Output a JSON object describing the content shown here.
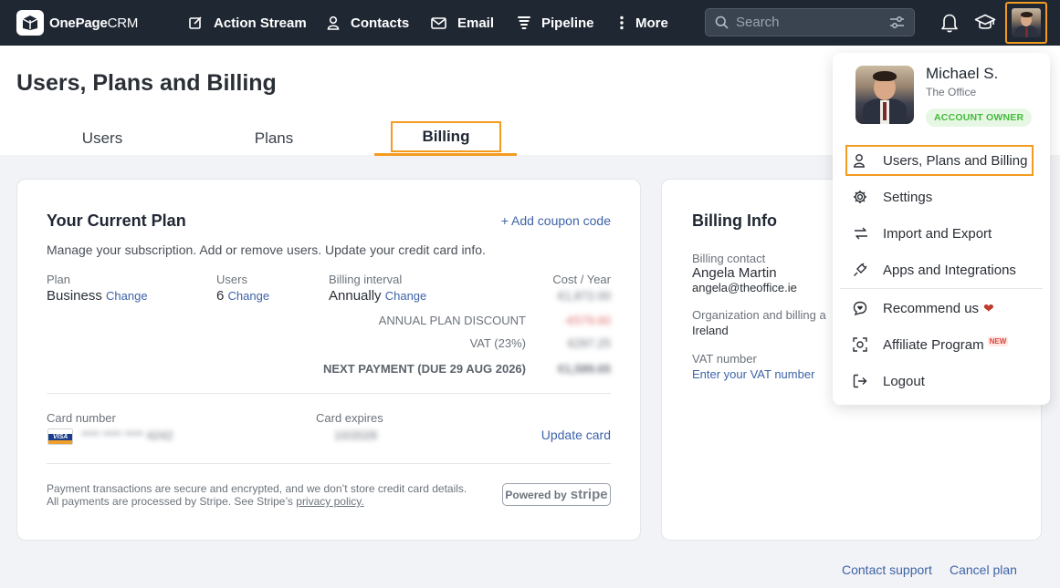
{
  "brand": {
    "name_bold": "OnePage",
    "name_thin": "CRM"
  },
  "nav": {
    "action_stream": "Action Stream",
    "contacts": "Contacts",
    "email": "Email",
    "pipeline": "Pipeline",
    "more": "More"
  },
  "search": {
    "placeholder": "Search"
  },
  "page": {
    "title": "Users, Plans and Billing",
    "tabs": {
      "users": "Users",
      "plans": "Plans",
      "billing": "Billing"
    },
    "active_tab": "Billing"
  },
  "current_plan": {
    "title": "Your Current Plan",
    "add_coupon": "+ Add coupon code",
    "description": "Manage your subscription. Add or remove users. Update your credit card info.",
    "plan_label": "Plan",
    "plan_value": "Business",
    "users_label": "Users",
    "users_value": "6",
    "interval_label": "Billing interval",
    "interval_value": "Annually",
    "change_link": "Change",
    "cost_label": "Cost / Year",
    "cost_value": "€1,872.00",
    "discount_label": "ANNUAL PLAN DISCOUNT",
    "discount_value": "-€579.60",
    "vat_label": "VAT (23%)",
    "vat_value": "€297.25",
    "next_payment_label": "NEXT PAYMENT (DUE 29 AUG 2026)",
    "next_payment_value": "€1,589.65",
    "card_number_label": "Card number",
    "card_number_value": "**** **** **** 4242",
    "card_expires_label": "Card expires",
    "card_expires_value": "10/2028",
    "update_card": "Update card",
    "security_note_1": "Payment transactions are secure and encrypted, and we don’t store credit card details.",
    "security_note_2": "All payments are processed by Stripe. See Stripe’s",
    "privacy_link": "privacy policy.",
    "powered_by": "Powered by",
    "stripe": "stripe"
  },
  "billing_info": {
    "title": "Billing Info",
    "contact_label": "Billing contact",
    "contact_name": "Angela Martin",
    "contact_email": "angela@theoffice.ie",
    "org_label": "Organization and billing a",
    "country": "Ireland",
    "vat_label": "VAT number",
    "vat_link": "Enter your VAT number"
  },
  "footer": {
    "contact_support": "Contact support",
    "cancel_plan": "Cancel plan"
  },
  "account_menu": {
    "name": "Michael S.",
    "company": "The Office",
    "role_badge": "ACCOUNT OWNER",
    "items": [
      {
        "label": "Users, Plans and Billing",
        "icon": "user-icon"
      },
      {
        "label": "Settings",
        "icon": "gear-icon"
      },
      {
        "label": "Import and Export",
        "icon": "import-export-icon"
      },
      {
        "label": "Apps and Integrations",
        "icon": "plug-icon"
      },
      {
        "label": "Recommend us",
        "icon": "chat-heart-icon"
      },
      {
        "label": "Affiliate Program",
        "icon": "affiliate-icon"
      },
      {
        "label": "Logout",
        "icon": "logout-icon"
      }
    ],
    "new_badge": "NEW",
    "heart": "❤"
  },
  "colors": {
    "nav_bg": "#1f2733",
    "accent": "#f39c20",
    "link": "#3e63a8",
    "badge_green": "#46b83d"
  }
}
